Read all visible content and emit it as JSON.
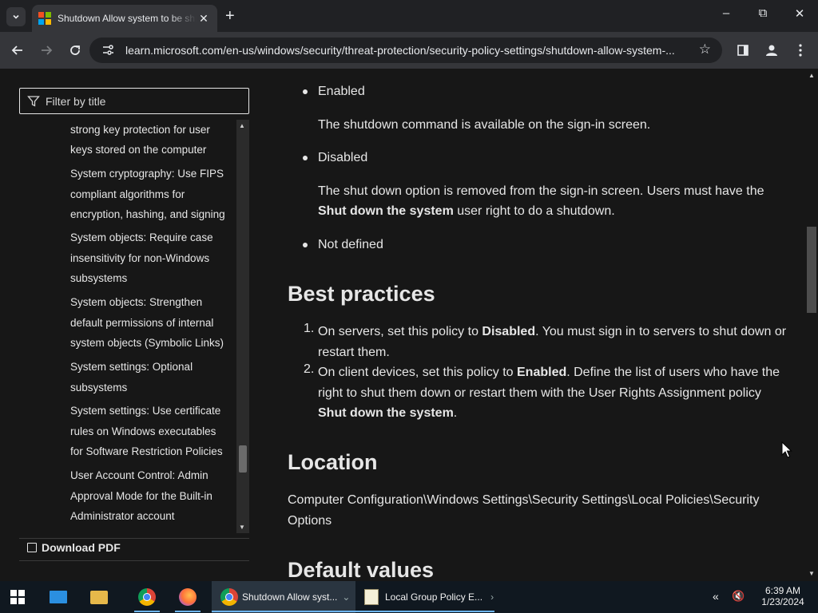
{
  "browser": {
    "tab_title": "Shutdown Allow system to be shut down without having to log on",
    "url": "learn.microsoft.com/en-us/windows/security/threat-protection/security-policy-settings/shutdown-allow-system-...",
    "window_controls": {
      "minimize": "–",
      "maximize": "⧉",
      "close": "✕"
    }
  },
  "sidebar": {
    "filter_placeholder": "Filter by title",
    "toc_items": [
      [
        "strong key protection for user",
        "keys stored on the computer"
      ],
      [
        "System cryptography: Use FIPS",
        "compliant algorithms for",
        "encryption, hashing, and signing"
      ],
      [
        "System objects: Require case",
        "insensitivity for non-Windows",
        "subsystems"
      ],
      [
        "System objects: Strengthen",
        "default permissions of internal",
        "system objects (Symbolic Links)"
      ],
      [
        "System settings: Optional",
        "subsystems"
      ],
      [
        "System settings: Use certificate",
        "rules on Windows executables",
        "for Software Restriction Policies"
      ],
      [
        "User Account Control: Admin",
        "Approval Mode for the Built-in",
        "Administrator account"
      ]
    ],
    "download_pdf": "Download PDF"
  },
  "content": {
    "enabled_label": "Enabled",
    "enabled_desc": "The shutdown command is available on the sign-in screen.",
    "disabled_label": "Disabled",
    "disabled_desc_1": "The shut down option is removed from the sign-in screen. Users must have the",
    "disabled_desc_bold": "Shut down the system",
    "disabled_desc_2": " user right to do a shutdown.",
    "notdefined_label": "Not defined",
    "best_practices_heading": "Best practices",
    "bp1_num": "1.",
    "bp1_a": "On servers, set this policy to ",
    "bp1_bold": "Disabled",
    "bp1_b": ". You must sign in to servers to shut down or",
    "bp1_c": "restart them.",
    "bp2_num": "2.",
    "bp2_a": "On client devices, set this policy to ",
    "bp2_bold": "Enabled",
    "bp2_b": ". Define the list of users who have the",
    "bp2_c": "right to shut them down or restart them with the User Rights Assignment policy",
    "bp2_bold2": "Shut down the system",
    "bp2_d": ".",
    "location_heading": "Location",
    "location_1": "Computer Configuration\\Windows Settings\\Security Settings\\Local Policies\\Security",
    "location_2": "Options",
    "default_values_heading": "Default values"
  },
  "taskbar": {
    "chrome_window": "Shutdown Allow syst...",
    "gp_window": "Local Group Policy E...",
    "time": "6:39 AM",
    "date": "1/23/2024"
  },
  "colors": {
    "page_bg": "#171717",
    "text": "#e6e6e6",
    "chrome_dark": "#202124",
    "chrome_toolbar": "#35363a",
    "taskbar_bg": "#101820"
  }
}
